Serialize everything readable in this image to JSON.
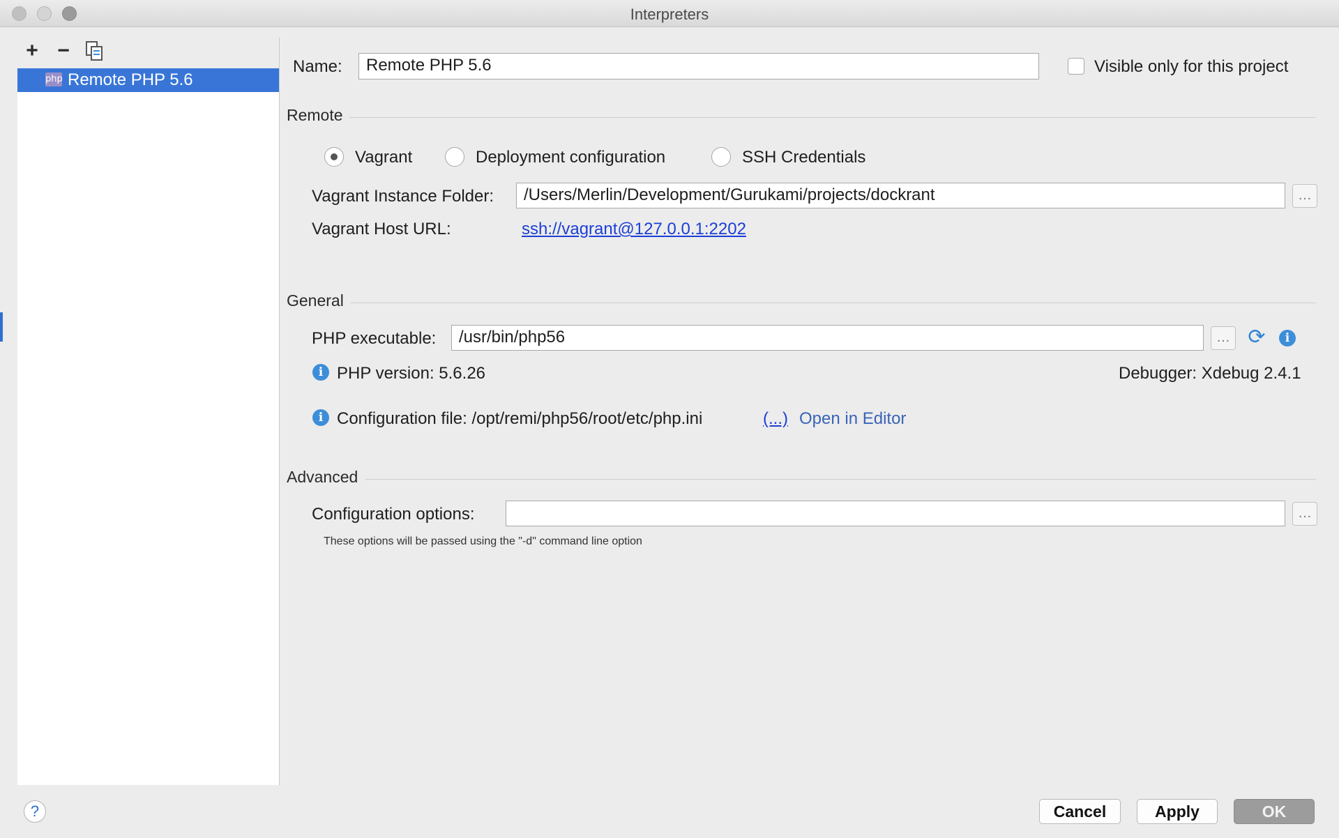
{
  "window": {
    "title": "Interpreters"
  },
  "toolbar": {
    "add_label": "+",
    "remove_label": "−",
    "copy_label": "⧉"
  },
  "interpreters": [
    {
      "label": "Remote PHP 5.6",
      "icon": "php-icon",
      "icon_text": "php"
    }
  ],
  "form": {
    "name_label": "Name:",
    "name_value": "Remote PHP 5.6",
    "visible_only_label": "Visible only for this project",
    "visible_only_checked": false
  },
  "remote": {
    "section_title": "Remote",
    "options": [
      {
        "label": "Vagrant",
        "selected": true
      },
      {
        "label": "Deployment configuration",
        "selected": false
      },
      {
        "label": "SSH Credentials",
        "selected": false
      }
    ],
    "folder_label": "Vagrant Instance Folder:",
    "folder_value": "/Users/Merlin/Development/Gurukami/projects/dockrant",
    "host_label": "Vagrant Host URL:",
    "host_url": "ssh://vagrant@127.0.0.1:2202",
    "browse_label": "…"
  },
  "general": {
    "section_title": "General",
    "php_exec_label": "PHP executable:",
    "php_exec_value": "/usr/bin/php56",
    "php_version": "PHP version: 5.6.26",
    "debugger": "Debugger: Xdebug 2.4.1",
    "config_file": "Configuration file: /opt/remi/php56/root/etc/php.ini",
    "config_more": "(...)",
    "open_in_editor": "Open in Editor"
  },
  "advanced": {
    "section_title": "Advanced",
    "config_options_label": "Configuration options:",
    "config_options_value": "",
    "hint": "These options will be passed using the \"-d\" command line option"
  },
  "buttons": {
    "help": "?",
    "cancel": "Cancel",
    "apply": "Apply",
    "ok": "OK"
  },
  "colors": {
    "selection": "#3875d7",
    "link": "#1b3fd6",
    "info": "#3d8ed8"
  }
}
